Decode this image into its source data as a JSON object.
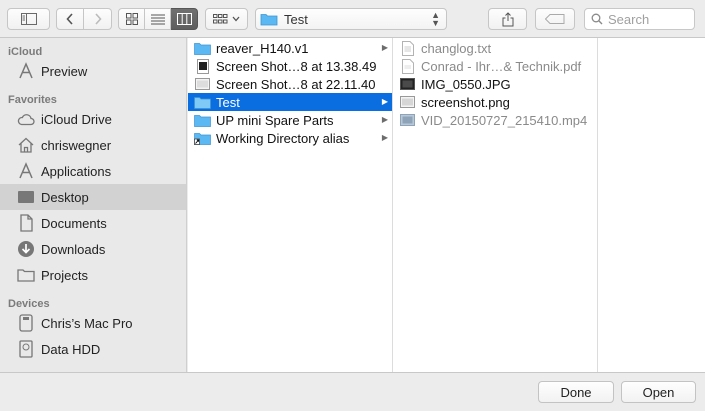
{
  "toolbar": {
    "current_folder": "Test",
    "search_placeholder": "Search"
  },
  "sidebar": {
    "sections": [
      {
        "header": "iCloud",
        "items": [
          {
            "label": "Preview",
            "icon": "preview-app-icon"
          }
        ]
      },
      {
        "header": "Favorites",
        "items": [
          {
            "label": "iCloud Drive",
            "icon": "cloud-icon"
          },
          {
            "label": "chriswegner",
            "icon": "home-icon"
          },
          {
            "label": "Applications",
            "icon": "applications-icon"
          },
          {
            "label": "Desktop",
            "icon": "desktop-icon",
            "selected": true
          },
          {
            "label": "Documents",
            "icon": "documents-icon"
          },
          {
            "label": "Downloads",
            "icon": "downloads-icon"
          },
          {
            "label": "Projects",
            "icon": "folder-icon"
          }
        ]
      },
      {
        "header": "Devices",
        "items": [
          {
            "label": "Chris’s Mac Pro",
            "icon": "computer-icon"
          },
          {
            "label": "Data HDD",
            "icon": "hard-drive-icon"
          }
        ]
      }
    ]
  },
  "column1": [
    {
      "label": "reaver_H140.v1",
      "icon": "folder-icon",
      "arrow": true
    },
    {
      "label": "Screen Shot…8 at 13.38.49",
      "icon": "screenshot-file-icon",
      "arrow": false
    },
    {
      "label": "Screen Shot…8 at 22.11.40",
      "icon": "screenshot-file-icon",
      "arrow": false
    },
    {
      "label": "Test",
      "icon": "folder-icon",
      "arrow": true,
      "selected": true
    },
    {
      "label": "UP mini Spare Parts",
      "icon": "folder-icon",
      "arrow": true
    },
    {
      "label": "Working Directory alias",
      "icon": "alias-folder-icon",
      "arrow": true
    }
  ],
  "column2": [
    {
      "label": "changlog.txt",
      "icon": "text-file-icon",
      "dim": true
    },
    {
      "label": "Conrad - Ihr…& Technik.pdf",
      "icon": "pdf-file-icon",
      "dim": true
    },
    {
      "label": "IMG_0550.JPG",
      "icon": "image-file-icon",
      "dim": false
    },
    {
      "label": "screenshot.png",
      "icon": "image-file-icon",
      "dim": false
    },
    {
      "label": "VID_20150727_215410.mp4",
      "icon": "video-file-icon",
      "dim": true
    }
  ],
  "footer": {
    "done_label": "Done",
    "open_label": "Open"
  },
  "colors": {
    "selection": "#0b6ee0",
    "folder": "#5bb8f2",
    "sidebar_selection": "#d2d2d2"
  }
}
